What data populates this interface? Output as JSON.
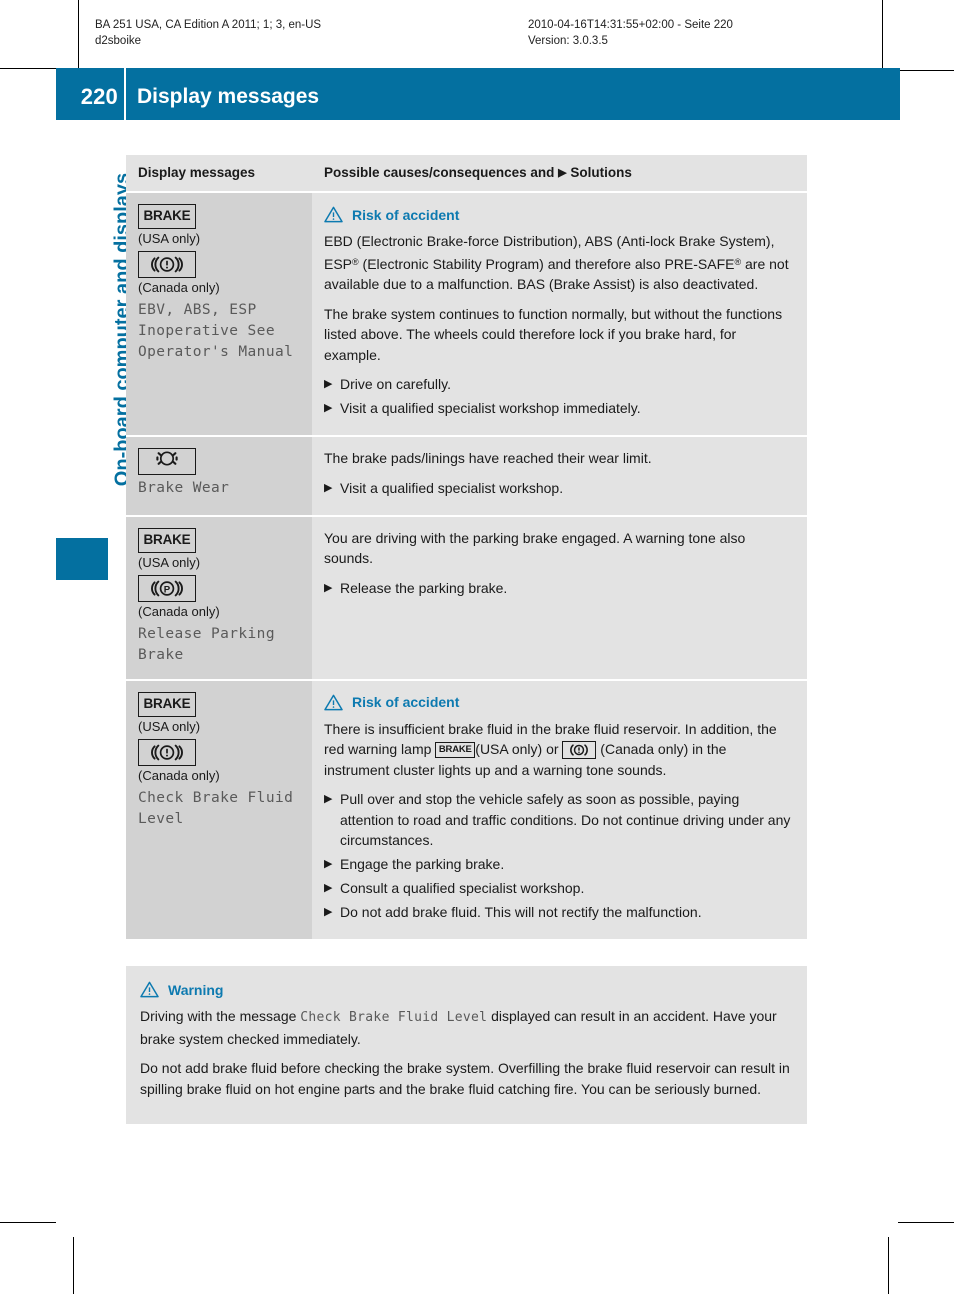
{
  "meta": {
    "left_line1": "BA 251 USA, CA Edition A 2011; 1; 3, en-US",
    "left_line2": "d2sboike",
    "right_line1": "2010-04-16T14:31:55+02:00 - Seite 220",
    "right_line2": "Version: 3.0.3.5"
  },
  "header": {
    "page_number": "220",
    "title": "Display messages",
    "running_head": "On-board computer and displays",
    "accent_color": "#0470a0"
  },
  "table": {
    "columns": {
      "left": "Display messages",
      "right_before_arrow": "Possible causes/consequences and ",
      "right_arrow": "▶",
      "right_after_arrow": " Solutions"
    },
    "rows": [
      {
        "icons": [
          {
            "type": "brake-text",
            "label": "BRAKE"
          },
          {
            "type": "region-note",
            "label": "(USA only)"
          },
          {
            "type": "brake-symbol-canada",
            "label": ""
          },
          {
            "type": "region-note",
            "label": "(Canada only)"
          }
        ],
        "message": "EBV, ABS, ESP\nInoperative See\nOperator's Manual",
        "warning_title": "Risk of accident",
        "paragraphs": [
          {
            "pre": "EBD (Electronic Brake-force Distribution), ABS (Anti-lock Brake System), ESP",
            "sup1": "®",
            "mid": " (Electronic Stability Program) and therefore also PRE-SAFE",
            "sup2": "®",
            "post": " are not available due to a malfunction. BAS (Brake Assist) is also deactivated."
          },
          {
            "pre": "The brake system continues to function normally, but without the functions listed above. The wheels could therefore lock if you brake hard, for example.",
            "sup1": "",
            "mid": "",
            "sup2": "",
            "post": ""
          }
        ],
        "bullets": [
          "Drive on carefully.",
          "Visit a qualified specialist workshop immediately."
        ]
      },
      {
        "icons": [
          {
            "type": "brake-wear-symbol",
            "label": ""
          }
        ],
        "message": "Brake Wear",
        "warning_title": "",
        "paragraphs": [
          {
            "pre": "The brake pads/linings have reached their wear limit.",
            "sup1": "",
            "mid": "",
            "sup2": "",
            "post": ""
          }
        ],
        "bullets": [
          "Visit a qualified specialist workshop."
        ]
      },
      {
        "icons": [
          {
            "type": "brake-text",
            "label": "BRAKE"
          },
          {
            "type": "region-note",
            "label": "(USA only)"
          },
          {
            "type": "parking-brake-symbol-canada",
            "label": ""
          },
          {
            "type": "region-note",
            "label": "(Canada only)"
          }
        ],
        "message": "Release Parking\nBrake",
        "warning_title": "",
        "paragraphs": [
          {
            "pre": "You are driving with the parking brake engaged. A warning tone also sounds.",
            "sup1": "",
            "mid": "",
            "sup2": "",
            "post": ""
          }
        ],
        "bullets": [
          "Release the parking brake."
        ]
      },
      {
        "icons": [
          {
            "type": "brake-text",
            "label": "BRAKE"
          },
          {
            "type": "region-note",
            "label": "(USA only)"
          },
          {
            "type": "brake-symbol-canada",
            "label": ""
          },
          {
            "type": "region-note",
            "label": "(Canada only)"
          }
        ],
        "message": "Check Brake Fluid\nLevel",
        "warning_title": "Risk of accident",
        "inline_paragraph": {
          "part1": "There is insufficient brake fluid in the brake fluid reservoir. In addition, the red warning lamp ",
          "icon1_label": "BRAKE",
          "part2": "(USA only) or ",
          "part3": " (Canada only) in the instrument cluster lights up and a warning tone sounds."
        },
        "bullets": [
          "Pull over and stop the vehicle safely as soon as possible, paying attention to road and traffic conditions. Do not continue driving under any circumstances.",
          "Engage the parking brake.",
          "Consult a qualified specialist workshop.",
          "Do not add brake fluid. This will not rectify the malfunction."
        ]
      }
    ]
  },
  "warning_box": {
    "title": "Warning",
    "para1_before": "Driving with the message ",
    "para1_lcd": "Check Brake Fluid Level",
    "para1_after": " displayed can result in an accident. Have your brake system checked immediately.",
    "para2": "Do not add brake fluid before checking the brake system. Overfilling the brake fluid reservoir can result in spilling brake fluid on hot engine parts and the brake fluid catching fire. You can be seriously burned."
  }
}
